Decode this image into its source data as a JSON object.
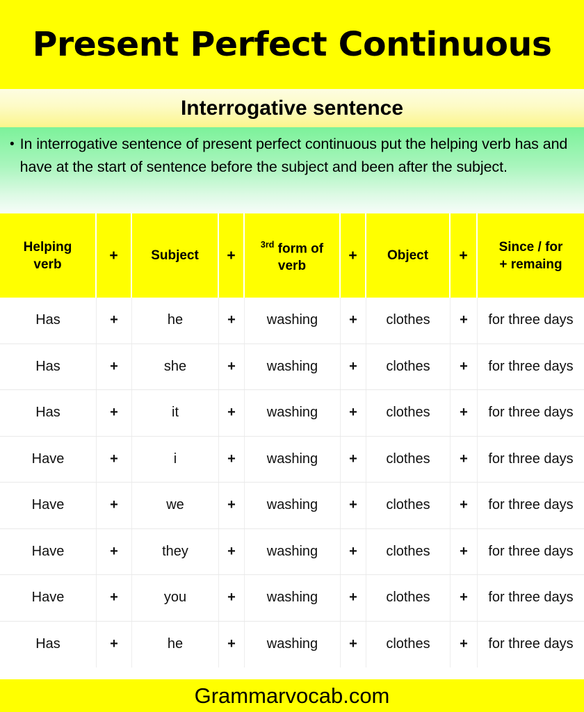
{
  "header": {
    "title": "Present Perfect Continuous",
    "subtitle": "Interrogative sentence"
  },
  "description": {
    "bullet_glyph": "•",
    "text": "In interrogative sentence of present perfect continuous put the helping verb has and have at the start of sentence before the subject and been after the subject."
  },
  "table": {
    "columns": [
      {
        "key": "helping_verb",
        "label_line1": "Helping",
        "label_line2": "verb"
      },
      {
        "key": "plus1",
        "label": "+"
      },
      {
        "key": "subject",
        "label": "Subject"
      },
      {
        "key": "plus2",
        "label": "+"
      },
      {
        "key": "verb_form",
        "label_sup": "3rd",
        "label_line1": " form of",
        "label_line2": "verb"
      },
      {
        "key": "plus3",
        "label": "+"
      },
      {
        "key": "object",
        "label": "Object"
      },
      {
        "key": "plus4",
        "label": "+"
      },
      {
        "key": "since_for",
        "label_line1": "Since / for",
        "label_line2": "+ remaing"
      }
    ],
    "rows": [
      {
        "helping_verb": "Has",
        "p1": "+",
        "subject": "he",
        "p2": "+",
        "verb_form": "washing",
        "p3": "+",
        "object": "clothes",
        "p4": "+",
        "since_for": "for three days"
      },
      {
        "helping_verb": "Has",
        "p1": "+",
        "subject": "she",
        "p2": "+",
        "verb_form": "washing",
        "p3": "+",
        "object": "clothes",
        "p4": "+",
        "since_for": "for three days"
      },
      {
        "helping_verb": "Has",
        "p1": "+",
        "subject": "it",
        "p2": "+",
        "verb_form": "washing",
        "p3": "+",
        "object": "clothes",
        "p4": "+",
        "since_for": "for three days"
      },
      {
        "helping_verb": "Have",
        "p1": "+",
        "subject": "i",
        "p2": "+",
        "verb_form": "washing",
        "p3": "+",
        "object": "clothes",
        "p4": "+",
        "since_for": "for three days"
      },
      {
        "helping_verb": "Have",
        "p1": "+",
        "subject": "we",
        "p2": "+",
        "verb_form": "washing",
        "p3": "+",
        "object": "clothes",
        "p4": "+",
        "since_for": "for three days"
      },
      {
        "helping_verb": "Have",
        "p1": "+",
        "subject": "they",
        "p2": "+",
        "verb_form": "washing",
        "p3": "+",
        "object": "clothes",
        "p4": "+",
        "since_for": "for three days"
      },
      {
        "helping_verb": "Have",
        "p1": "+",
        "subject": "you",
        "p2": "+",
        "verb_form": "washing",
        "p3": "+",
        "object": "clothes",
        "p4": "+",
        "since_for": "for three days"
      },
      {
        "helping_verb": "Has",
        "p1": "+",
        "subject": "he",
        "p2": "+",
        "verb_form": "washing",
        "p3": "+",
        "object": "clothes",
        "p4": "+",
        "since_for": "for three days"
      }
    ]
  },
  "footer": {
    "site": "Grammarvocab.com"
  },
  "colors": {
    "accent_yellow": "#ffff00",
    "band_green": "#7cf29a",
    "band_pale_yellow": "#fdfde2",
    "text": "#000000"
  }
}
